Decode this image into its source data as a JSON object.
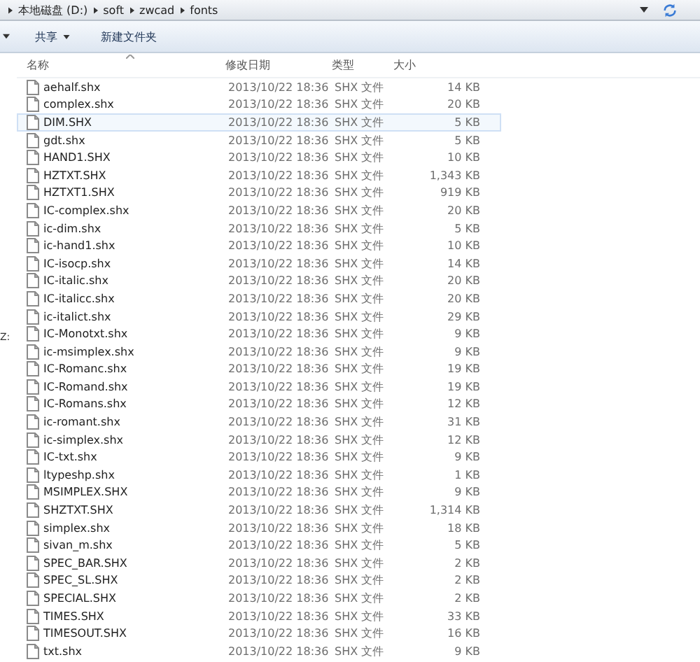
{
  "address_bar": {
    "segments": [
      "本地磁盘 (D:)",
      "soft",
      "zwcad",
      "fonts"
    ]
  },
  "toolbar": {
    "buttons": [
      {
        "label": "共享",
        "dropdown": true
      },
      {
        "label": "新建文件夹",
        "dropdown": false
      }
    ]
  },
  "sidebar": {
    "items": [
      "Z:"
    ]
  },
  "table": {
    "columns": [
      "名称",
      "修改日期",
      "类型",
      "大小"
    ],
    "rows": [
      {
        "name": "aehalf.shx",
        "modified": "2013/10/22 18:36",
        "type": "SHX 文件",
        "size": "14 KB",
        "selected": false
      },
      {
        "name": "complex.shx",
        "modified": "2013/10/22 18:36",
        "type": "SHX 文件",
        "size": "20 KB",
        "selected": false
      },
      {
        "name": "DIM.SHX",
        "modified": "2013/10/22 18:36",
        "type": "SHX 文件",
        "size": "5 KB",
        "selected": true
      },
      {
        "name": "gdt.shx",
        "modified": "2013/10/22 18:36",
        "type": "SHX 文件",
        "size": "5 KB",
        "selected": false
      },
      {
        "name": "HAND1.SHX",
        "modified": "2013/10/22 18:36",
        "type": "SHX 文件",
        "size": "10 KB",
        "selected": false
      },
      {
        "name": "HZTXT.SHX",
        "modified": "2013/10/22 18:36",
        "type": "SHX 文件",
        "size": "1,343 KB",
        "selected": false
      },
      {
        "name": "HZTXT1.SHX",
        "modified": "2013/10/22 18:36",
        "type": "SHX 文件",
        "size": "919 KB",
        "selected": false
      },
      {
        "name": "IC-complex.shx",
        "modified": "2013/10/22 18:36",
        "type": "SHX 文件",
        "size": "20 KB",
        "selected": false
      },
      {
        "name": "ic-dim.shx",
        "modified": "2013/10/22 18:36",
        "type": "SHX 文件",
        "size": "5 KB",
        "selected": false
      },
      {
        "name": "ic-hand1.shx",
        "modified": "2013/10/22 18:36",
        "type": "SHX 文件",
        "size": "10 KB",
        "selected": false
      },
      {
        "name": "IC-isocp.shx",
        "modified": "2013/10/22 18:36",
        "type": "SHX 文件",
        "size": "14 KB",
        "selected": false
      },
      {
        "name": "IC-italic.shx",
        "modified": "2013/10/22 18:36",
        "type": "SHX 文件",
        "size": "20 KB",
        "selected": false
      },
      {
        "name": "IC-italicc.shx",
        "modified": "2013/10/22 18:36",
        "type": "SHX 文件",
        "size": "20 KB",
        "selected": false
      },
      {
        "name": "ic-italict.shx",
        "modified": "2013/10/22 18:36",
        "type": "SHX 文件",
        "size": "29 KB",
        "selected": false
      },
      {
        "name": "IC-Monotxt.shx",
        "modified": "2013/10/22 18:36",
        "type": "SHX 文件",
        "size": "9 KB",
        "selected": false
      },
      {
        "name": "ic-msimplex.shx",
        "modified": "2013/10/22 18:36",
        "type": "SHX 文件",
        "size": "9 KB",
        "selected": false
      },
      {
        "name": "IC-Romanc.shx",
        "modified": "2013/10/22 18:36",
        "type": "SHX 文件",
        "size": "19 KB",
        "selected": false
      },
      {
        "name": "IC-Romand.shx",
        "modified": "2013/10/22 18:36",
        "type": "SHX 文件",
        "size": "19 KB",
        "selected": false
      },
      {
        "name": "IC-Romans.shx",
        "modified": "2013/10/22 18:36",
        "type": "SHX 文件",
        "size": "12 KB",
        "selected": false
      },
      {
        "name": "ic-romant.shx",
        "modified": "2013/10/22 18:36",
        "type": "SHX 文件",
        "size": "31 KB",
        "selected": false
      },
      {
        "name": "ic-simplex.shx",
        "modified": "2013/10/22 18:36",
        "type": "SHX 文件",
        "size": "12 KB",
        "selected": false
      },
      {
        "name": "IC-txt.shx",
        "modified": "2013/10/22 18:36",
        "type": "SHX 文件",
        "size": "9 KB",
        "selected": false
      },
      {
        "name": "ltypeshp.shx",
        "modified": "2013/10/22 18:36",
        "type": "SHX 文件",
        "size": "1 KB",
        "selected": false
      },
      {
        "name": "MSIMPLEX.SHX",
        "modified": "2013/10/22 18:36",
        "type": "SHX 文件",
        "size": "9 KB",
        "selected": false
      },
      {
        "name": "SHZTXT.SHX",
        "modified": "2013/10/22 18:36",
        "type": "SHX 文件",
        "size": "1,314 KB",
        "selected": false
      },
      {
        "name": "simplex.shx",
        "modified": "2013/10/22 18:36",
        "type": "SHX 文件",
        "size": "18 KB",
        "selected": false
      },
      {
        "name": "sivan_m.shx",
        "modified": "2013/10/22 18:36",
        "type": "SHX 文件",
        "size": "5 KB",
        "selected": false
      },
      {
        "name": "SPEC_BAR.SHX",
        "modified": "2013/10/22 18:36",
        "type": "SHX 文件",
        "size": "2 KB",
        "selected": false
      },
      {
        "name": "SPEC_SL.SHX",
        "modified": "2013/10/22 18:36",
        "type": "SHX 文件",
        "size": "2 KB",
        "selected": false
      },
      {
        "name": "SPECIAL.SHX",
        "modified": "2013/10/22 18:36",
        "type": "SHX 文件",
        "size": "2 KB",
        "selected": false
      },
      {
        "name": "TIMES.SHX",
        "modified": "2013/10/22 18:36",
        "type": "SHX 文件",
        "size": "33 KB",
        "selected": false
      },
      {
        "name": "TIMESOUT.SHX",
        "modified": "2013/10/22 18:36",
        "type": "SHX 文件",
        "size": "16 KB",
        "selected": false
      },
      {
        "name": "txt.shx",
        "modified": "2013/10/22 18:36",
        "type": "SHX 文件",
        "size": "9 KB",
        "selected": false
      }
    ]
  }
}
